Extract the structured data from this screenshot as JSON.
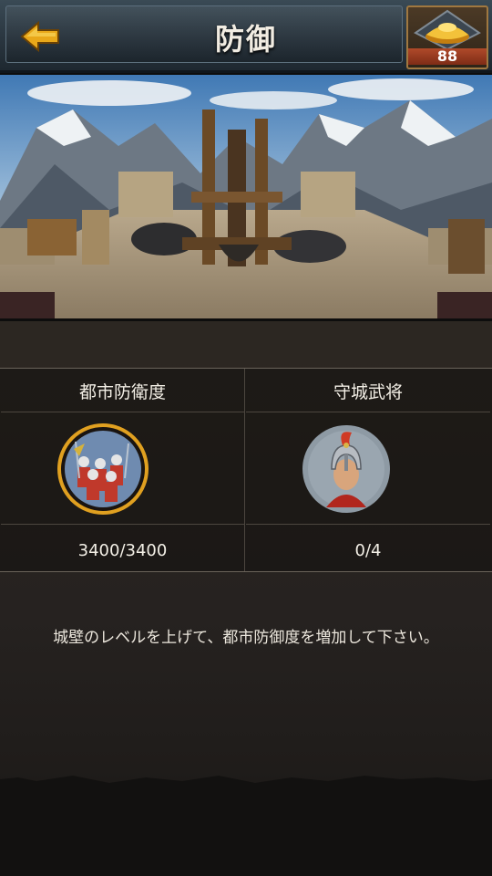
{
  "header": {
    "title": "防御",
    "back_icon": "back-arrow-icon",
    "currency": {
      "icon": "gold-ingot-icon",
      "amount": "88"
    }
  },
  "banner": {
    "scene": "city-wall-ballista-mountain-view"
  },
  "defense_table": {
    "columns": [
      {
        "header": "都市防衛度",
        "icon": "soldier-troop-icon",
        "value": "3400/3400"
      },
      {
        "header": "守城武将",
        "icon": "general-helmet-icon",
        "value": "0/4"
      }
    ]
  },
  "hint_text": "城壁のレベルを上げて、都市防御度を増加して下さい。",
  "colors": {
    "accent_gold": "#e0a020",
    "header_blue": "#2a3640",
    "badge_red": "#a0402a"
  }
}
